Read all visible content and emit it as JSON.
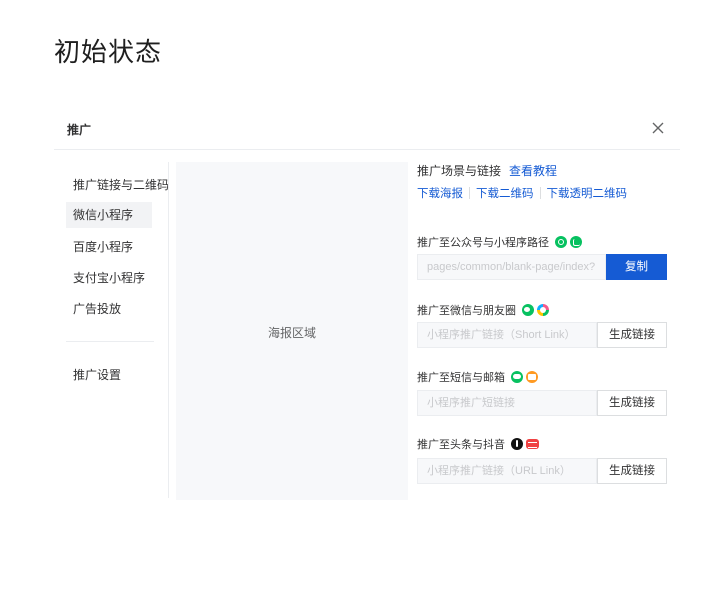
{
  "page_title": "初始状态",
  "dialog": {
    "title": "推广"
  },
  "nav": {
    "items": [
      {
        "label": "推广链接与二维码",
        "active": false
      },
      {
        "label": "微信小程序",
        "active": true
      },
      {
        "label": "百度小程序",
        "active": false
      },
      {
        "label": "支付宝小程序",
        "active": false
      },
      {
        "label": "广告投放",
        "active": false
      }
    ],
    "settings_label": "推广设置"
  },
  "poster": {
    "label": "海报区域"
  },
  "panel": {
    "scene_title": "推广场景与链接",
    "tutorial_link": "查看教程",
    "downloads": [
      "下载海报",
      "下载二维码",
      "下载透明二维码"
    ],
    "sections": [
      {
        "title": "推广至公众号与小程序路径",
        "icons": [
          "wechat-official-account-icon",
          "mini-program-icon"
        ],
        "input_value": "pages/common/blank-page/index?",
        "input_placeholder": "",
        "button": "复制"
      },
      {
        "title": "推广至微信与朋友圈",
        "icons": [
          "wechat-icon",
          "moments-icon"
        ],
        "input_value": "",
        "input_placeholder": "小程序推广链接（Short Link）",
        "button": "生成链接"
      },
      {
        "title": "推广至短信与邮箱",
        "icons": [
          "sms-icon",
          "mail-icon"
        ],
        "input_value": "",
        "input_placeholder": "小程序推广短链接",
        "button": "生成链接"
      },
      {
        "title": "推广至头条与抖音",
        "icons": [
          "douyin-icon",
          "toutiao-icon"
        ],
        "input_value": "",
        "input_placeholder": "小程序推广链接（URL Link）",
        "button": "生成链接"
      }
    ]
  },
  "colors": {
    "primary": "#155bd4",
    "nav_active_bg": "#f2f3f5",
    "poster_bg": "#f7f8fa",
    "wechat_green": "#07c160"
  }
}
